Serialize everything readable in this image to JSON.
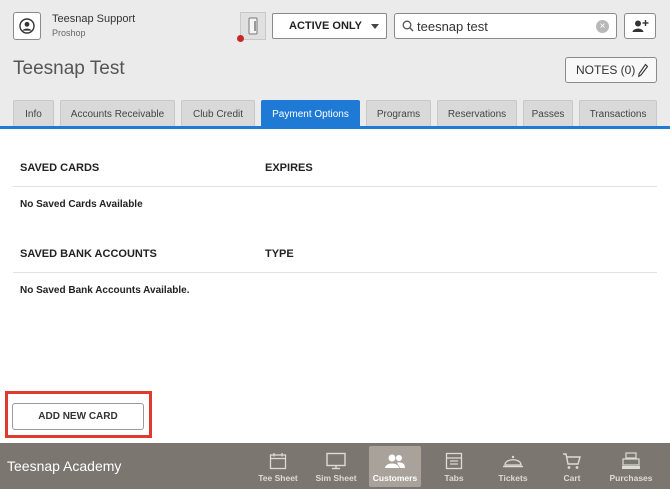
{
  "header": {
    "user_name": "Teesnap Support",
    "user_role": "Proshop",
    "filter_value": "ACTIVE ONLY",
    "search_value": "teesnap test",
    "page_title": "Teesnap Test",
    "notes_label": "NOTES (0)"
  },
  "tabs": [
    {
      "label": "Info"
    },
    {
      "label": "Accounts Receivable"
    },
    {
      "label": "Club Credit"
    },
    {
      "label": "Payment Options",
      "active": true
    },
    {
      "label": "Programs"
    },
    {
      "label": "Reservations"
    },
    {
      "label": "Passes"
    },
    {
      "label": "Transactions"
    }
  ],
  "cards": {
    "col_saved": "SAVED CARDS",
    "col_expires": "EXPIRES",
    "empty": "No Saved Cards Available"
  },
  "banks": {
    "col_saved": "SAVED BANK ACCOUNTS",
    "col_type": "TYPE",
    "empty": "No Saved Bank Accounts Available."
  },
  "add_card_label": "ADD NEW CARD",
  "footer": {
    "academy": "Teesnap Academy",
    "nav": [
      {
        "label": "Tee Sheet",
        "icon": "calendar-icon"
      },
      {
        "label": "Sim Sheet",
        "icon": "monitor-icon"
      },
      {
        "label": "Customers",
        "icon": "people-icon",
        "active": true
      },
      {
        "label": "Tabs",
        "icon": "tabs-icon"
      },
      {
        "label": "Tickets",
        "icon": "cloche-icon"
      },
      {
        "label": "Cart",
        "icon": "cart-icon"
      },
      {
        "label": "Purchases",
        "icon": "register-icon"
      }
    ]
  },
  "colors": {
    "accent": "#1f7ad6",
    "highlight": "#e03a2f",
    "footer": "#7b7670",
    "alert_dot": "#c62828"
  }
}
